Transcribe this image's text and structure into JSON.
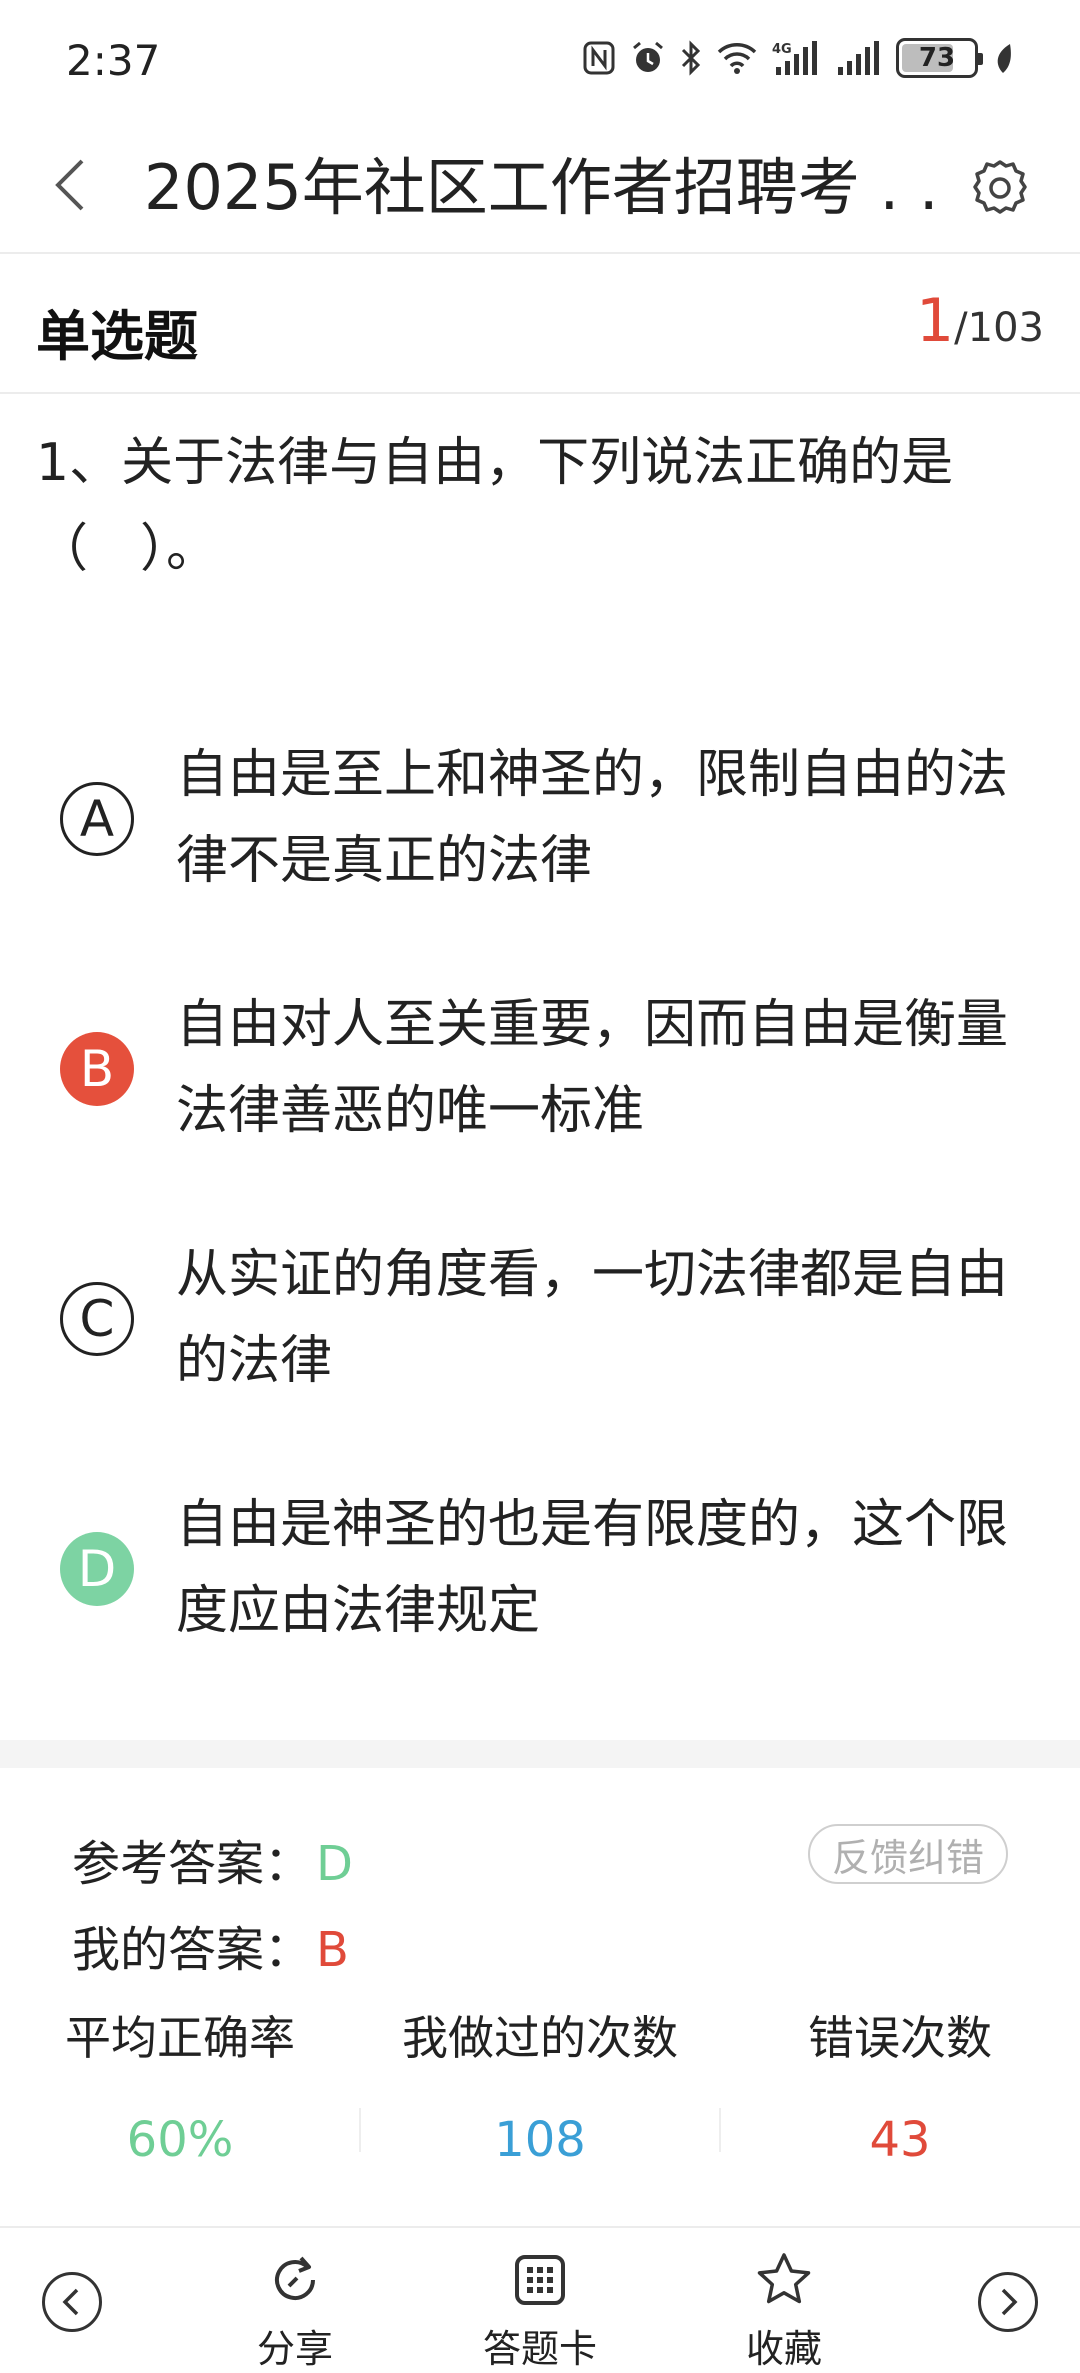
{
  "status_bar": {
    "time": "2:37",
    "battery": "73",
    "battery_level": 0.73,
    "icons": [
      "nfc-icon",
      "alarm-icon",
      "bluetooth-icon",
      "wifi-icon",
      "signal-4g-icon",
      "signal-icon",
      "leaf-icon"
    ]
  },
  "header": {
    "title": "2025年社区工作者招聘考 . ."
  },
  "question_meta": {
    "type_label": "单选题",
    "current": "1",
    "total": "/103"
  },
  "question": {
    "text": "1、关于法律与自由，下列说法正确的是（　）。"
  },
  "options": [
    {
      "letter": "A",
      "text": "自由是至上和神圣的，限制自由的法律不是真正的法律",
      "state": "plain"
    },
    {
      "letter": "B",
      "text": "自由对人至关重要，因而自由是衡量法律善恶的唯一标准",
      "state": "wrong"
    },
    {
      "letter": "C",
      "text": "从实证的角度看，一切法律都是自由的法律",
      "state": "plain"
    },
    {
      "letter": "D",
      "text": "自由是神圣的也是有限度的，这个限度应由法律规定",
      "state": "right"
    }
  ],
  "answer": {
    "ref_label": "参考答案：",
    "ref_value": "D",
    "mine_label": "我的答案：",
    "mine_value": "B",
    "feedback_label": "反馈纠错"
  },
  "stats": [
    {
      "label": "平均正确率",
      "value": "60%",
      "color": "#6fce95"
    },
    {
      "label": "我做过的次数",
      "value": "108",
      "color": "#3a9fd6"
    },
    {
      "label": "错误次数",
      "value": "43",
      "color": "#e04a3a"
    }
  ],
  "bottom_bar": {
    "share_label": "分享",
    "card_label": "答题卡",
    "fav_label": "收藏"
  },
  "colors": {
    "accent_red": "#e04a3a",
    "accent_green": "#6fce95",
    "accent_blue": "#3a9fd6"
  }
}
